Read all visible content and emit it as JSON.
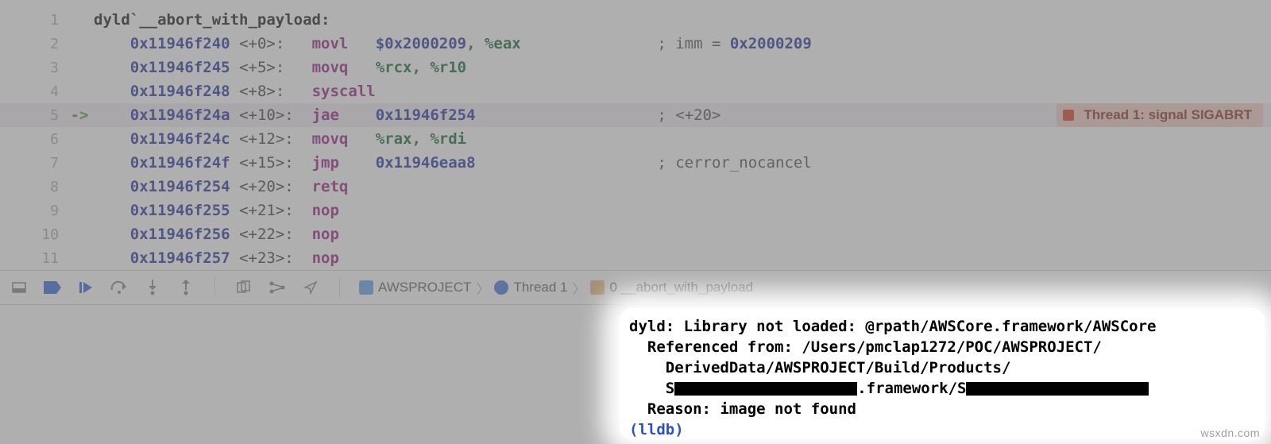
{
  "disasm": {
    "header": "dyld`__abort_with_payload:",
    "lines": [
      {
        "n": 1,
        "arrow": "",
        "addr": "",
        "offset": "",
        "op": "",
        "args": "",
        "comment": "",
        "header": true
      },
      {
        "n": 2,
        "arrow": "",
        "addr": "0x11946f240",
        "offset": "<+0>:",
        "op": "movl",
        "args_num": "$0x2000209",
        "args_rest": ", %eax",
        "comment": "; imm = ",
        "comment_num": "0x2000209"
      },
      {
        "n": 3,
        "arrow": "",
        "addr": "0x11946f245",
        "offset": "<+5>:",
        "op": "movq",
        "args_reg": "%rcx, %r10"
      },
      {
        "n": 4,
        "arrow": "",
        "addr": "0x11946f248",
        "offset": "<+8>:",
        "op": "syscall"
      },
      {
        "n": 5,
        "arrow": "->",
        "addr": "0x11946f24a",
        "offset": "<+10>:",
        "op": "jae",
        "args_addr": "0x11946f254",
        "comment": "; <+20>",
        "current": true
      },
      {
        "n": 6,
        "arrow": "",
        "addr": "0x11946f24c",
        "offset": "<+12>:",
        "op": "movq",
        "args_reg": "%rax, %rdi"
      },
      {
        "n": 7,
        "arrow": "",
        "addr": "0x11946f24f",
        "offset": "<+15>:",
        "op": "jmp",
        "args_addr": "0x11946eaa8",
        "comment": "; cerror_nocancel"
      },
      {
        "n": 8,
        "arrow": "",
        "addr": "0x11946f254",
        "offset": "<+20>:",
        "op": "retq"
      },
      {
        "n": 9,
        "arrow": "",
        "addr": "0x11946f255",
        "offset": "<+21>:",
        "op": "nop"
      },
      {
        "n": 10,
        "arrow": "",
        "addr": "0x11946f256",
        "offset": "<+22>:",
        "op": "nop"
      },
      {
        "n": 11,
        "arrow": "",
        "addr": "0x11946f257",
        "offset": "<+23>:",
        "op": "nop"
      }
    ]
  },
  "thread_badge": "Thread 1: signal SIGABRT",
  "breadcrumb": {
    "project": "AWSPROJECT",
    "thread": "Thread 1",
    "frame": "0 __abort_with_payload"
  },
  "console": {
    "l1": "dyld: Library not loaded: @rpath/AWSCore.framework/AWSCore",
    "l2": "  Referenced from: /Users/pmclap1272/POC/AWSPROJECT/",
    "l3": "    DerivedData/AWSPROJECT/Build/Products/",
    "l4a": "    S",
    "l4b": ".framework/S",
    "l5": "  Reason: image not found",
    "prompt": "(lldb) "
  },
  "watermark": "wsxdn.com"
}
